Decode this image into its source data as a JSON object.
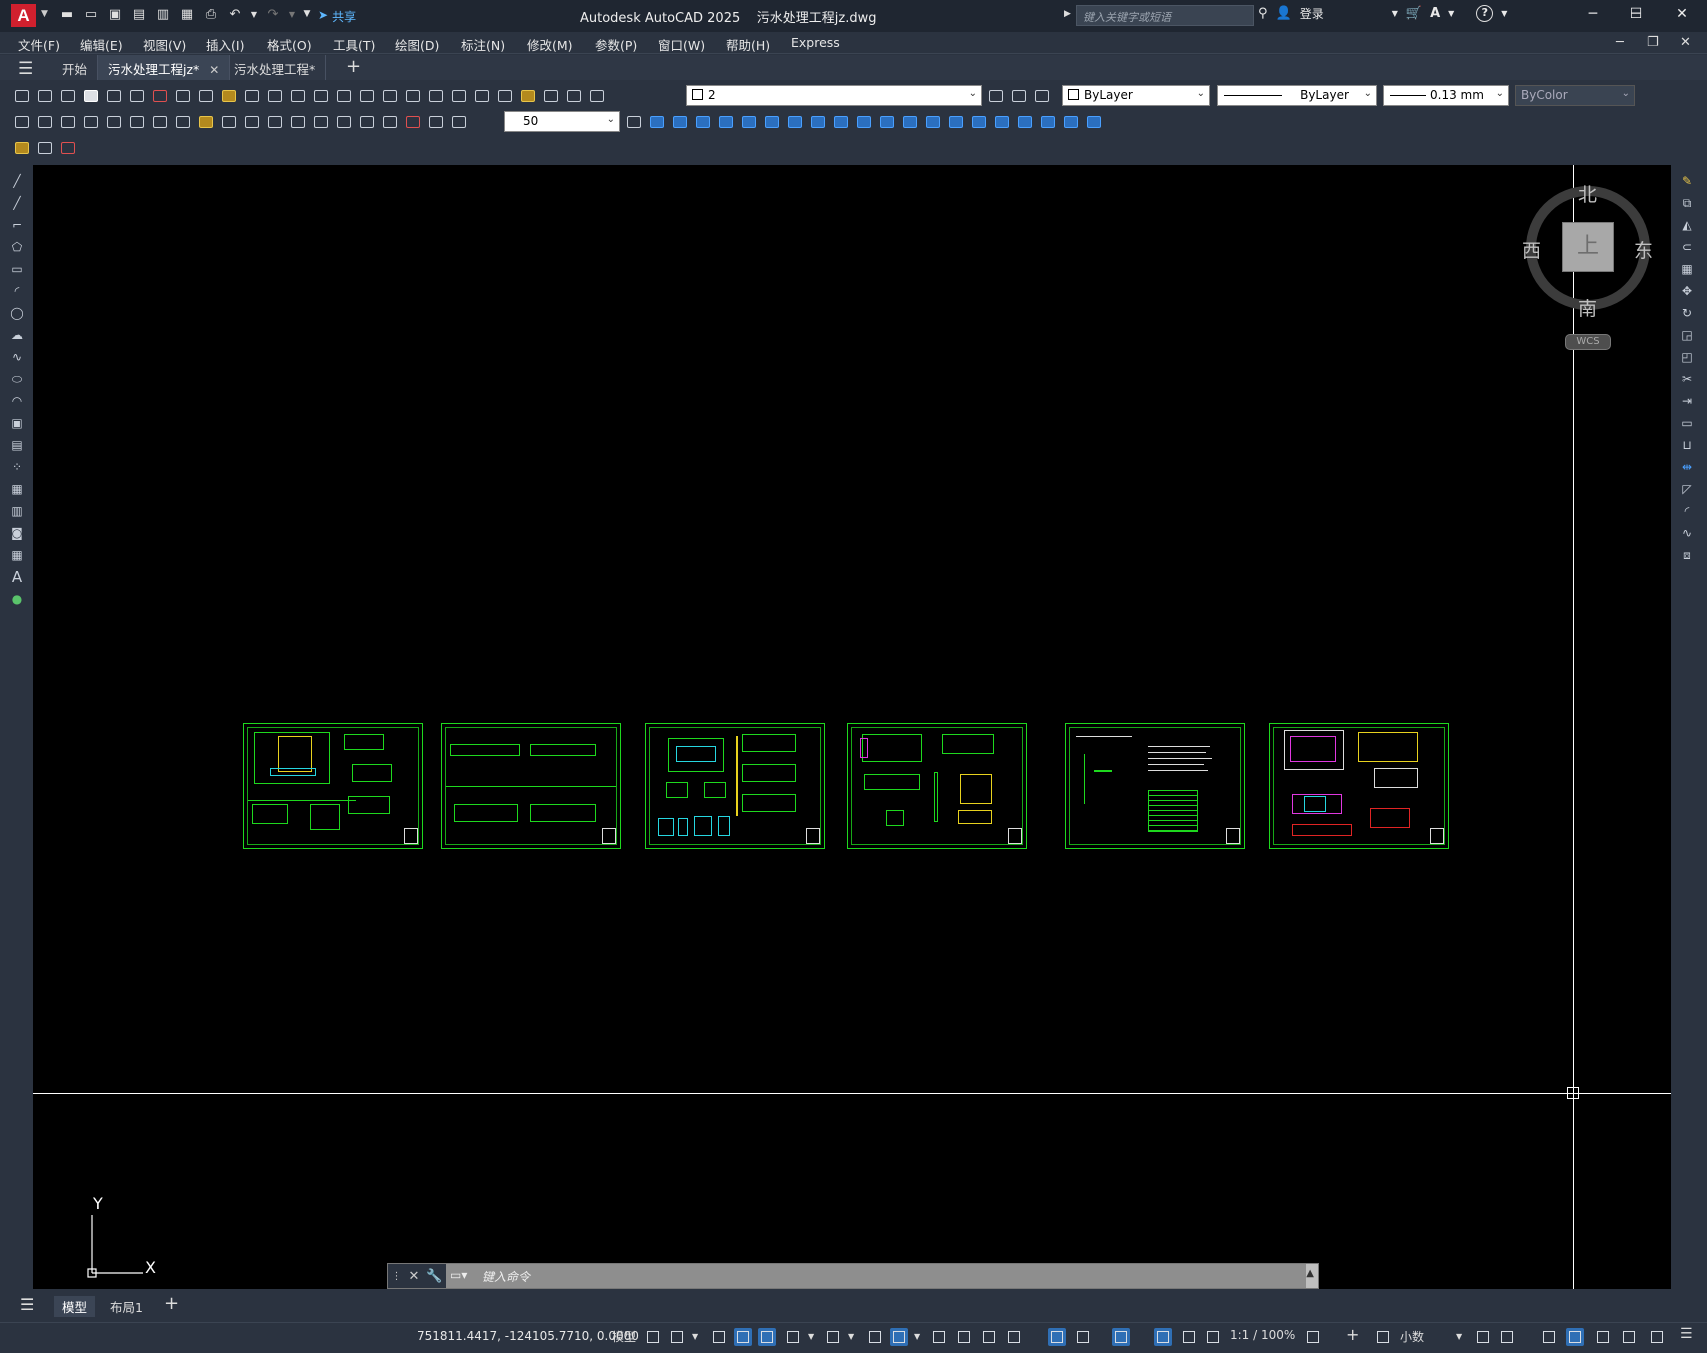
{
  "app": {
    "logo_letter": "A",
    "title": "Autodesk AutoCAD 2025    污水处理工程jz.dwg",
    "share_label": "共享",
    "search_placeholder": "键入关键字或短语",
    "login_label": "登录",
    "help_label": "?"
  },
  "menu": [
    "文件(F)",
    "编辑(E)",
    "视图(V)",
    "插入(I)",
    "格式(O)",
    "工具(T)",
    "绘图(D)",
    "标注(N)",
    "修改(M)",
    "参数(P)",
    "窗口(W)",
    "帮助(H)",
    "Express"
  ],
  "tabs": [
    {
      "label": "开始"
    },
    {
      "label": "污水处理工程jz*"
    },
    {
      "label": "污水处理工程*"
    }
  ],
  "toolbar": {
    "layer_name": "2",
    "color": "ByLayer",
    "linetype": "ByLayer",
    "lineweight": "0.13 mm",
    "plotstyle": "ByColor",
    "dim_scale": "50"
  },
  "viewcube": {
    "north": "北",
    "south": "南",
    "east": "东",
    "west": "西",
    "top": "上",
    "wcs": "WCS"
  },
  "ucs": {
    "x": "X",
    "y": "Y"
  },
  "command": {
    "placeholder": "键入命令"
  },
  "layout_tabs": [
    {
      "label": "模型"
    },
    {
      "label": "布局1"
    }
  ],
  "status": {
    "coordinates": "751811.4417, -124105.7710, 0.0000",
    "space": "模型",
    "scale": "1:1 / 100%",
    "units": "小数"
  },
  "colors": {
    "canvas": "#000000",
    "frame": "#1ed81e",
    "accent": "#2f6fb5"
  },
  "drawing_sheets": 6
}
